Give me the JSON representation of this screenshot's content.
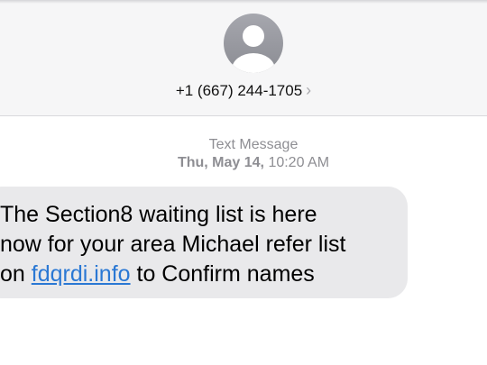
{
  "contact": {
    "number": "+1 (667) 244-1705",
    "chevron": "›"
  },
  "thread": {
    "service": "Text Message",
    "date": "Thu, May 14,",
    "time": "10:20 AM"
  },
  "message": {
    "line1": "The Section8 waiting list is here",
    "line2": "now for your area Michael refer list",
    "line3_prefix": "on ",
    "link": "fdqrdi.info",
    "line3_suffix": " to Confirm names"
  },
  "colors": {
    "header_bg": "#f6f6f7",
    "bubble_bg": "#e9e9eb",
    "link": "#2a78d4",
    "meta_text": "#8e8e93"
  }
}
